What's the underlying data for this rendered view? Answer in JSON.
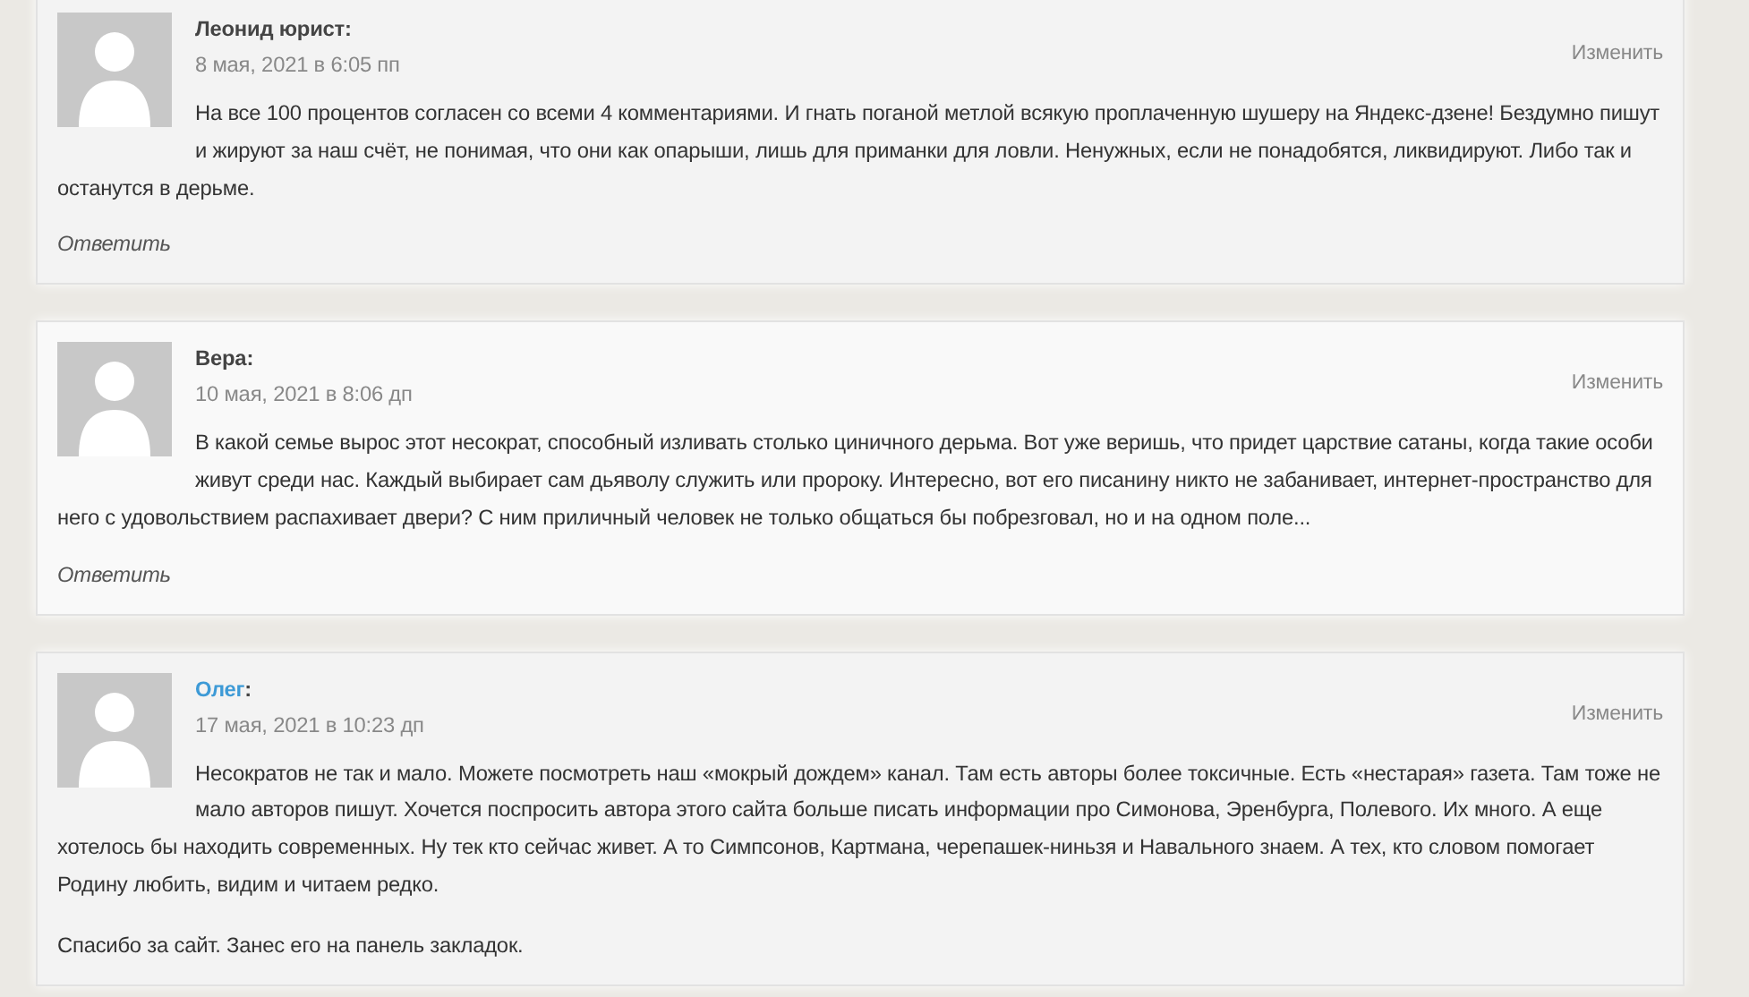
{
  "comments": [
    {
      "author": "Леонид юрист",
      "author_link": false,
      "separator": ":",
      "date": "8 мая, 2021 в 6:05 пп",
      "edit": "Изменить",
      "paragraphs": [
        "На все 100 процентов согласен со всеми 4 комментариями. И гнать поганой метлой всякую проплаченную шушеру на Яндекс-дзене! Бездумно пишут и жируют за наш счёт, не понимая, что они как опарыши, лишь для приманки для ловли. Ненужных, если не понадобятся, ликвидируют. Либо так и останутся в дерьме."
      ],
      "reply": "Ответить"
    },
    {
      "author": "Вера",
      "author_link": false,
      "separator": ":",
      "date": "10 мая, 2021 в 8:06 дп",
      "edit": "Изменить",
      "paragraphs": [
        "В какой семье вырос этот несократ, способный изливать столько циничного дерьма. Вот уже веришь, что придет царствие сатаны, когда такие особи живут среди нас. Каждый выбирает сам дьяволу служить или пророку. Интересно, вот его писанину никто не забанивает, интернет-пространство для него с удовольствием распахивает двери? С ним приличный человек не только общаться бы побрезговал, но и на одном поле..."
      ],
      "reply": "Ответить"
    },
    {
      "author": "Олег",
      "author_link": true,
      "separator": ":",
      "date": "17 мая, 2021 в 10:23 дп",
      "edit": "Изменить",
      "paragraphs": [
        "Несократов не так и мало. Можете посмотреть наш «мокрый дождем» канал. Там есть авторы более токсичные. Есть «нестарая» газета. Там тоже не мало авторов пишут. Хочется поспросить автора этого сайта больше писать информации про Симонова, Эренбурга, Полевого. Их много. А еще хотелось бы находить современных. Ну тек кто сейчас живет. А то Симпсонов, Картмана, черепашек-ниньзя и Навального знаем. А тех, кто словом помогает Родину любить, видим и читаем редко.",
        "Спасибо за сайт. Занес его на панель закладок."
      ]
    }
  ]
}
